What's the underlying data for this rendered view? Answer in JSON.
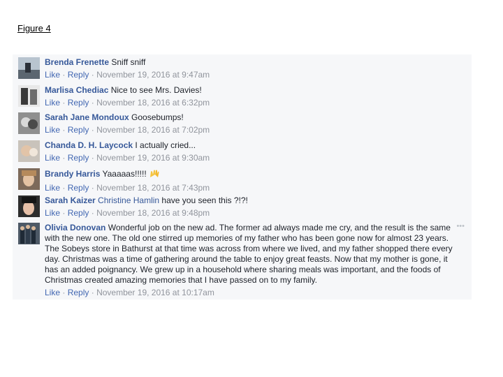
{
  "figure_label": "Figure 4",
  "action_labels": {
    "like": "Like",
    "reply": "Reply",
    "separator": "·"
  },
  "more_icon": "more-options-icon",
  "comments": [
    {
      "author": "Brenda Frenette",
      "tag": "",
      "text": "Sniff sniff",
      "timestamp": "November 19, 2016 at 9:47am"
    },
    {
      "author": "Marlisa Chediac",
      "tag": "",
      "text": "Nice to see Mrs. Davies!",
      "timestamp": "November 18, 2016 at 6:32pm"
    },
    {
      "author": "Sarah Jane Mondoux",
      "tag": "",
      "text": "Goosebumps!",
      "timestamp": "November 18, 2016 at 7:02pm"
    },
    {
      "author": "Chanda D. H. Laycock",
      "tag": "",
      "text": "I actually cried...",
      "timestamp": "November 19, 2016 at 9:30am"
    },
    {
      "author": "Brandy Harris",
      "tag": "",
      "text": "Yaaaaas!!!!!",
      "emoji": "raised-hands-emoji",
      "timestamp": "November 18, 2016 at 7:43pm"
    },
    {
      "author": "Sarah Kaizer",
      "tag": "Christine Hamlin",
      "text": "have you seen this ?!?!",
      "timestamp": "November 18, 2016 at 9:48pm"
    },
    {
      "author": "Olivia Donovan",
      "tag": "",
      "text": "Wonderful job on the new ad. The former ad always made me cry, and the result is the same with the new one. The old one stirred up memories of my father who has been gone now for almost 23 years. The Sobeys store in Bathurst at that time was across from where we lived, and my father shopped there every day. Christmas was a time of gathering around the table to enjoy great feasts. Now that my mother is gone, it has an added poignancy. We grew up in a household where sharing meals was important, and the foods of Christmas created amazing memories that I have passed on to my family.",
      "timestamp": "November 19, 2016 at 10:17am"
    }
  ],
  "colors": {
    "author": "#365899",
    "action": "#4267b2",
    "meta": "#90949c",
    "panel_bg": "#f6f7f9"
  }
}
